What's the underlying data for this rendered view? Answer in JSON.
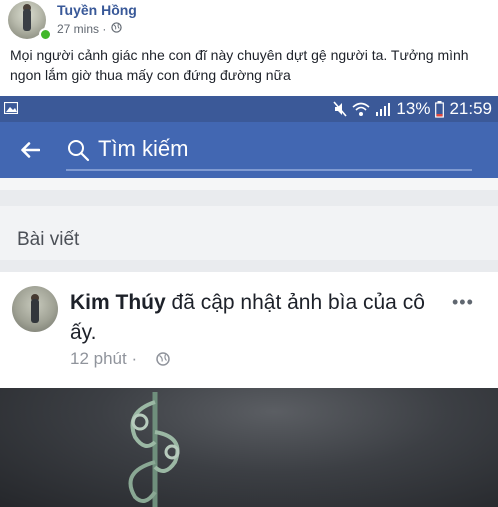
{
  "post": {
    "author": "Tuyền Hồng",
    "time": "27 mins ·",
    "caption": "Mọi người cảnh giác nhe con đĩ này chuyên dựt gệ người ta. Tưởng mình ngon lắm giờ thua mấy con đứng đường nữa"
  },
  "screenshot": {
    "status_bar": {
      "battery_percent": "13%",
      "clock": "21:59",
      "icons": [
        "image-icon",
        "mute-icon",
        "wifi-icon",
        "signal-icon",
        "battery-icon"
      ]
    },
    "search": {
      "placeholder": "Tìm kiếm"
    },
    "section_title": "Bài viết",
    "card": {
      "name": "Kim Thúy",
      "action": "đã cập nhật ảnh bìa của cô ấy.",
      "meta": "12 phút ·",
      "more": "•••"
    }
  },
  "colors": {
    "facebook_blue": "#3b5998",
    "navbar_blue": "#4267b2",
    "link_blue": "#385898",
    "online_green": "#42b72a"
  }
}
